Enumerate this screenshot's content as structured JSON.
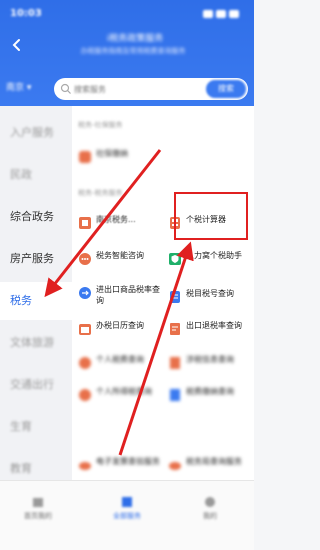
{
  "status_bar": {
    "time": "10:03"
  },
  "header": {
    "title": "i税务政策服务",
    "subtitle": "办税服务指南及常用税费查询服务"
  },
  "search": {
    "region": "南京",
    "placeholder": "搜索服务",
    "button": "搜索"
  },
  "sidebar": {
    "items": [
      {
        "label": "入户服务"
      },
      {
        "label": "民政"
      },
      {
        "label": "综合政务"
      },
      {
        "label": "房产服务"
      },
      {
        "label": "税务"
      },
      {
        "label": "文体旅游"
      },
      {
        "label": "交通出行"
      },
      {
        "label": "生育"
      },
      {
        "label": "教育"
      }
    ]
  },
  "content": {
    "section_top": "税务-社保服务",
    "top_item": "社保缴纳",
    "section_tax": "税务-税务服务",
    "items": [
      {
        "label": "南京税务...",
        "icon": "tax-logo-icon"
      },
      {
        "label": "个税计算器",
        "icon": "calculator-icon"
      },
      {
        "label": "税务智能咨询",
        "icon": "chat-icon"
      },
      {
        "label": "人力窝个税助手",
        "icon": "shield-icon"
      },
      {
        "label": "进出口商品税率查询",
        "icon": "import-export-icon"
      },
      {
        "label": "税目税号查询",
        "icon": "ledger-icon"
      },
      {
        "label": "办税日历查询",
        "icon": "calendar-icon"
      },
      {
        "label": "出口退税率查询",
        "icon": "document-icon"
      },
      {
        "label": "个人税费查询",
        "icon": "person-icon"
      },
      {
        "label": "涉税信息查询",
        "icon": "document-icon"
      },
      {
        "label": "个人所得税查询",
        "icon": "person-icon"
      },
      {
        "label": "税费缴纳查询",
        "icon": "ledger-icon"
      },
      {
        "label": "电子发票查验服务",
        "icon": "cloud-icon"
      },
      {
        "label": "税务局查询服务",
        "icon": "cloud-icon"
      }
    ]
  },
  "tabbar": {
    "items": [
      {
        "label": "首页我的"
      },
      {
        "label": "全部服务"
      },
      {
        "label": "我的"
      }
    ]
  },
  "colors": {
    "accent": "#2f6ee8",
    "annotation": "#e02020"
  }
}
